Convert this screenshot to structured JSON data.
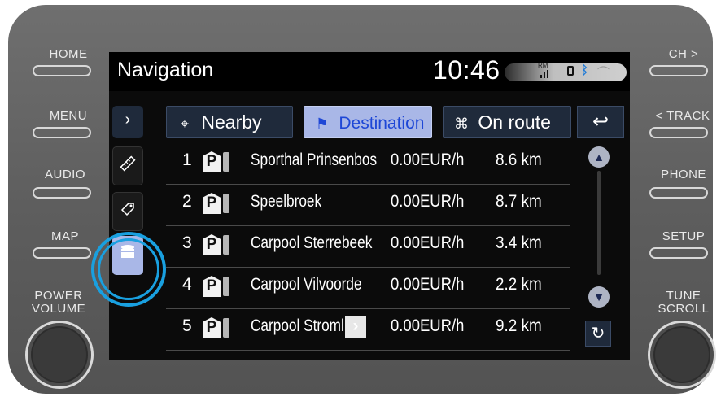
{
  "hardware": {
    "left_buttons": [
      "HOME",
      "MENU",
      "AUDIO",
      "MAP"
    ],
    "left_knob_label_1": "POWER",
    "left_knob_label_2": "VOLUME",
    "right_buttons": [
      "CH >",
      "< TRACK",
      "PHONE",
      "SETUP"
    ],
    "right_knob_label_1": "TUNE",
    "right_knob_label_2": "SCROLL"
  },
  "header": {
    "title": "Navigation",
    "time": "10:46",
    "status": {
      "rm": "RM",
      "signal_icon": "signal-icon",
      "battery_icon": "battery-icon",
      "bluetooth_icon": "bluetooth-icon",
      "wifi_icon": "wifi-icon"
    }
  },
  "sidebar": {
    "expand_icon": "chevron-right-icon",
    "items": [
      {
        "icon": "ruler-icon"
      },
      {
        "icon": "tag-icon"
      },
      {
        "icon": "stack-icon",
        "active": true
      }
    ]
  },
  "tabs": [
    {
      "label": "Nearby",
      "icon": "map-pin-icon",
      "active": false
    },
    {
      "label": "Destination",
      "icon": "checkered-flag-icon",
      "active": true
    },
    {
      "label": "On route",
      "icon": "route-icon",
      "active": false
    }
  ],
  "back_icon": "back-arrow-icon",
  "list": [
    {
      "num": "1",
      "name": "Sporthal Prinsenbos",
      "price": "0.00EUR/h",
      "distance": "8.6 km"
    },
    {
      "num": "2",
      "name": "Speelbroek",
      "price": "0.00EUR/h",
      "distance": "8.7 km"
    },
    {
      "num": "3",
      "name": "Carpool Sterrebeek",
      "price": "0.00EUR/h",
      "distance": "3.4 km"
    },
    {
      "num": "4",
      "name": "Carpool Vilvoorde",
      "price": "0.00EUR/h",
      "distance": "2.2 km"
    },
    {
      "num": "5",
      "name": "Carpool Stroml",
      "price": "0.00EUR/h",
      "distance": "9.2 km"
    }
  ],
  "parking_symbol": "P",
  "more_symbol": "›",
  "colors": {
    "accent": "#a9b7e7",
    "active_text": "#1e47d6",
    "highlight_ring": "#19a0e0",
    "screen_bg": "#0b0b0b"
  }
}
